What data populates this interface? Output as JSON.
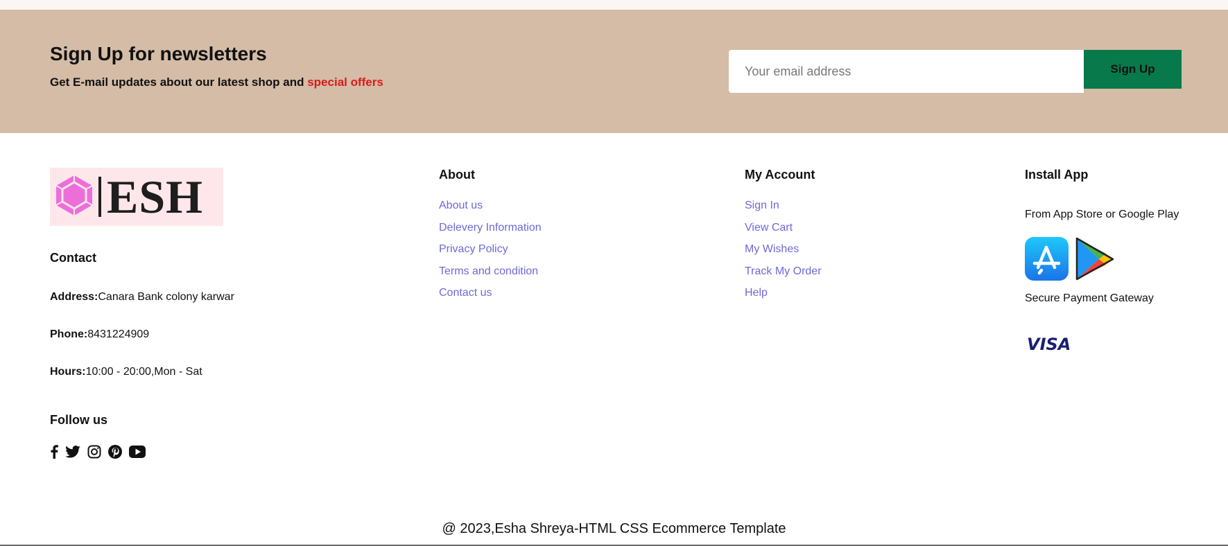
{
  "newsletter": {
    "title": "Sign Up for newsletters",
    "subtitle_text": "Get E-mail updates about our latest shop and ",
    "subtitle_highlight": "special offers",
    "email_placeholder": "Your email address",
    "signup_label": "Sign Up",
    "colors": {
      "band": "#d4bca6",
      "button": "#07794b",
      "highlight": "#d81b1b"
    }
  },
  "brand": {
    "logo_text": "ESH",
    "logo_icon": "hexagon-icon"
  },
  "contact": {
    "heading": "Contact",
    "address_label": "Address:",
    "address_value": "Canara Bank colony karwar",
    "phone_label": "Phone:",
    "phone_value": "8431224909",
    "hours_label": "Hours:",
    "hours_value": "10:00 - 20:00,Mon - Sat"
  },
  "follow": {
    "heading": "Follow us",
    "icons": [
      "facebook-icon",
      "twitter-icon",
      "instagram-icon",
      "pinterest-icon",
      "youtube-icon"
    ]
  },
  "about": {
    "heading": "About",
    "links": [
      "About us",
      "Delevery Information",
      "Privacy Policy",
      "Terms and condition",
      "Contact us"
    ]
  },
  "account": {
    "heading": "My Account",
    "links": [
      "Sign In",
      "View Cart",
      "My Wishes",
      "Track My Order",
      "Help"
    ]
  },
  "install": {
    "heading": "Install App",
    "stores_text": "From App Store or Google Play",
    "payment_text": "Secure Payment Gateway",
    "payment_brand": "VISA",
    "store_icons": [
      "app-store-icon",
      "google-play-icon"
    ]
  },
  "footer": {
    "copyright": "@ 2023,Esha Shreya-HTML CSS Ecommerce Template"
  },
  "link_color": "#6d69d8"
}
